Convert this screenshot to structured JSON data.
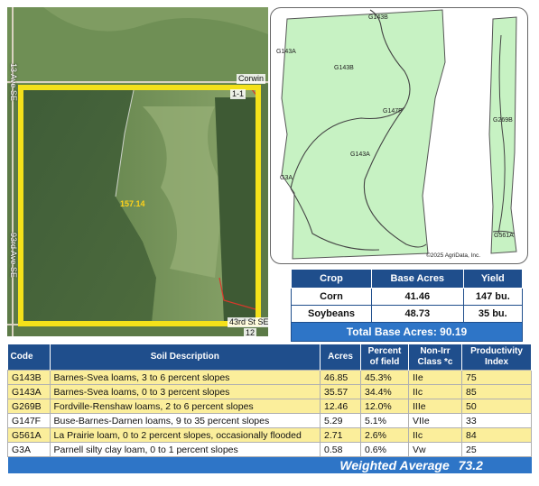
{
  "aerial": {
    "roads": {
      "top_right": "Corwin",
      "top_right_2": "1-1",
      "bottom": "43rd St SE",
      "bottom_right": "12",
      "left_top": "13 Ave SE",
      "left_bottom": "93rd Ave SE"
    },
    "acre_label": "157.14",
    "colors": {
      "boundary": "#f4e11a",
      "field": "#4d6a3e"
    }
  },
  "soil_map": {
    "labels": [
      "G143B",
      "G143A",
      "G143B",
      "G147F",
      "G143A",
      "G269B",
      "G3A",
      "G561A",
      "G143A"
    ],
    "copyright": "©2025 AgriData, Inc.",
    "colors": {
      "fill": "#c7f2c3",
      "line": "#555555"
    }
  },
  "crop_table": {
    "headers": [
      "Crop",
      "Base Acres",
      "Yield"
    ],
    "rows": [
      {
        "crop": "Corn",
        "base_acres": "41.46",
        "yield": "147 bu."
      },
      {
        "crop": "Soybeans",
        "base_acres": "48.73",
        "yield": "35 bu."
      }
    ],
    "total": "Total Base Acres:  90.19"
  },
  "soil_table": {
    "headers": {
      "code": "Code",
      "description": "Soil Description",
      "acres": "Acres",
      "percent": "Percent of field",
      "class": "Non-Irr Class *c",
      "index": "Productivity Index"
    },
    "rows": [
      {
        "code": "G143B",
        "description": "Barnes-Svea loams, 3 to 6 percent slopes",
        "acres": "46.85",
        "percent": "45.3%",
        "class": "IIe",
        "index": "75",
        "highlight": true
      },
      {
        "code": "G143A",
        "description": "Barnes-Svea loams, 0 to 3 percent slopes",
        "acres": "35.57",
        "percent": "34.4%",
        "class": "IIc",
        "index": "85",
        "highlight": true
      },
      {
        "code": "G269B",
        "description": "Fordville-Renshaw loams, 2 to 6 percent slopes",
        "acres": "12.46",
        "percent": "12.0%",
        "class": "IIIe",
        "index": "50",
        "highlight": true
      },
      {
        "code": "G147F",
        "description": "Buse-Barnes-Darnen loams, 9 to 35 percent slopes",
        "acres": "5.29",
        "percent": "5.1%",
        "class": "VIIe",
        "index": "33",
        "highlight": false
      },
      {
        "code": "G561A",
        "description": "La Prairie loam, 0 to 2 percent slopes, occasionally flooded",
        "acres": "2.71",
        "percent": "2.6%",
        "class": "IIc",
        "index": "84",
        "highlight": true
      },
      {
        "code": "G3A",
        "description": "Parnell silty clay loam, 0 to 1 percent slopes",
        "acres": "0.58",
        "percent": "0.6%",
        "class": "Vw",
        "index": "25",
        "highlight": false
      }
    ],
    "weighted_label": "Weighted Average",
    "weighted_value": "73.2"
  }
}
